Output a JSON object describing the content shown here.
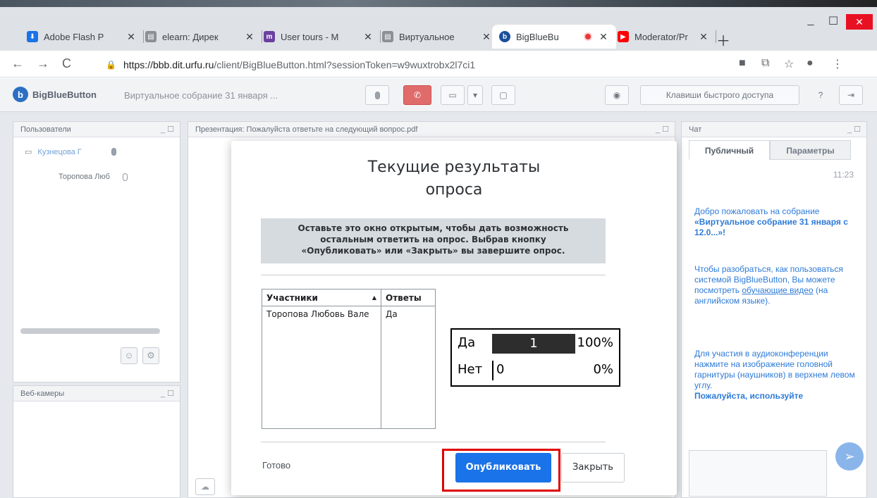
{
  "browser": {
    "tabs": [
      {
        "title": "Adobe Flash P",
        "favicon_color": "#1a73e8",
        "favicon_glyph": "⬇"
      },
      {
        "title": "elearn: Дирек",
        "favicon_color": "#8a9096",
        "favicon_glyph": "▤"
      },
      {
        "title": "User tours - M",
        "favicon_color": "#6b3fa0",
        "favicon_glyph": "m"
      },
      {
        "title": "Виртуальное",
        "favicon_color": "#8a9096",
        "favicon_glyph": "▤"
      },
      {
        "title": "BigBlueBu",
        "favicon_color": "#1b4f9b",
        "favicon_glyph": "b",
        "active": true
      },
      {
        "title": "Moderator/Pr",
        "favicon_color": "#ff0000",
        "favicon_glyph": "▶"
      }
    ],
    "new_tab_icon": "plus-icon",
    "url_host": "https://bbb.dit.urfu.ru",
    "url_path": "/client/BigBlueButton.html?sessionToken=w9wuxtrobx2l7ci1"
  },
  "app": {
    "brand": "BigBlueButton",
    "meeting_title": "Виртуальное собрание 31 января ...",
    "shortcuts_label": "Клавиши быстрого доступа",
    "accent_color": "#2b6fc2"
  },
  "users_panel": {
    "title": "Пользователи",
    "users": [
      {
        "name": "Кузнецова Г",
        "is_presenter": true
      },
      {
        "name": "Торопова Люб",
        "is_presenter": false
      }
    ]
  },
  "webcams_panel": {
    "title": "Веб-камеры"
  },
  "presentation_panel": {
    "title": "Презентация: Пожалуйста ответьте на следующий вопрос.pdf"
  },
  "chat_panel": {
    "title": "Чат",
    "tab_public": "Публичный",
    "tab_params": "Параметры",
    "time": "11:23",
    "welcome_prefix": "Добро пожаловать на собрание",
    "welcome_bold": "«Виртуальное собрание 31 января  с 12.0...»!",
    "help_1": "Чтобы разобраться, как пользоваться системой BigBlueButton, Вы можете посмотреть",
    "help_link": "обучающие видео",
    "help_2": "(на английском языке).",
    "audio_text": "Для участия в аудиоконференции нажмите на изображение головной гарнитуры (наушников) в верхнем левом углу.",
    "audio_bold": "Пожалуйста, используйте"
  },
  "poll_modal": {
    "title_line1": "Текущие результаты",
    "title_line2": "опроса",
    "notice_line1": "Оставьте это окно открытым, чтобы дать возможность",
    "notice_line2": "остальным ответить на опрос. Выбрав кнопку",
    "notice_line3": "«Опубликовать» или «Закрыть» вы завершите опрос.",
    "table": {
      "col_participants": "Участники",
      "col_answers": "Ответы",
      "rows": [
        {
          "participant": "Торопова Любовь Вале",
          "answer": "Да"
        }
      ]
    },
    "done_label": "Готово",
    "publish_label": "Опубликовать",
    "close_label": "Закрыть",
    "highlight_color": "#e00000"
  },
  "chart_data": {
    "type": "bar",
    "orientation": "horizontal",
    "categories": [
      "Да",
      "Нет"
    ],
    "counts": [
      1,
      0
    ],
    "percent_labels": [
      "100%",
      "0%"
    ],
    "values": [
      100,
      0
    ]
  }
}
